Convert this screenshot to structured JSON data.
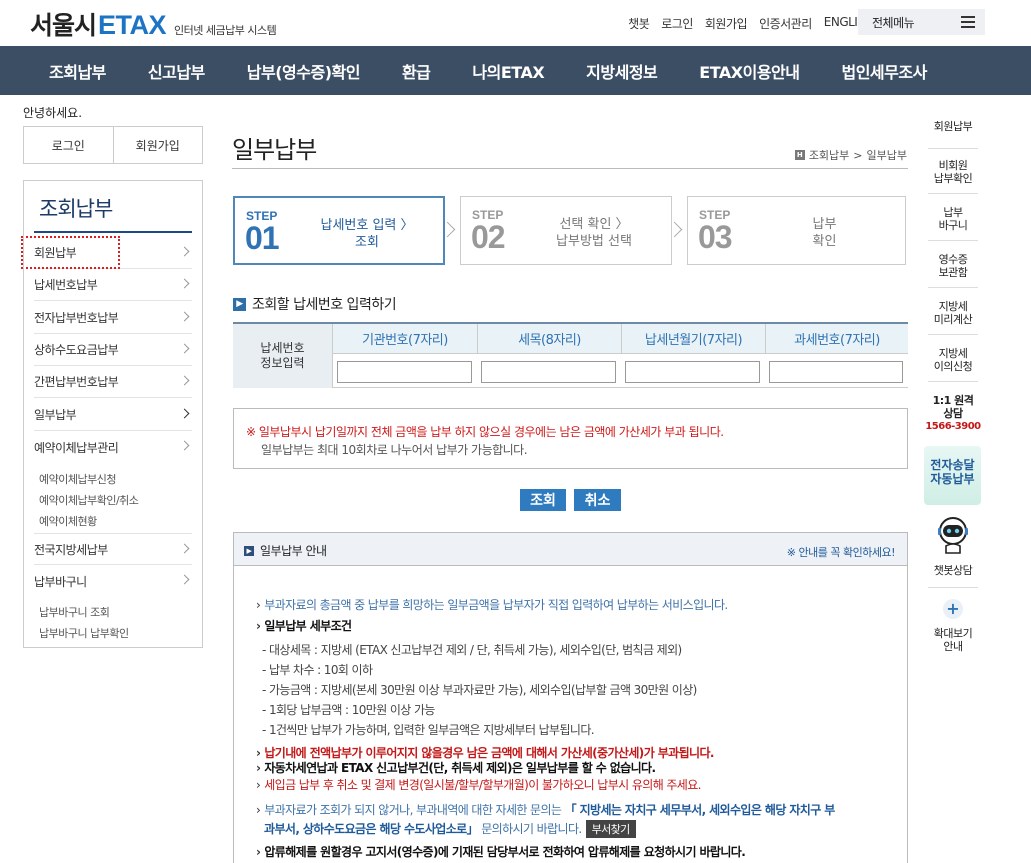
{
  "header": {
    "logo_main": "서울시",
    "logo_etax": "ETAX",
    "logo_sub": "인터넷 세금납부 시스템",
    "util_links": [
      "챗봇",
      "로그인",
      "회원가입",
      "인증서관리",
      "ENGLISH"
    ],
    "all_menu": "전체메뉴"
  },
  "gnb": [
    "조회납부",
    "신고납부",
    "납부(영수증)확인",
    "환급",
    "나의ETAX",
    "지방세정보",
    "ETAX이용안내",
    "법인세무조사"
  ],
  "left": {
    "greeting": "안녕하세요.",
    "login": "로그인",
    "join": "회원가입",
    "lnb_title": "조회납부",
    "items": [
      "회원납부",
      "납세번호납부",
      "전자납부번호납부",
      "상하수도요금납부",
      "간편납부번호납부",
      "일부납부",
      "예약이체납부관리"
    ],
    "reserve_sub": [
      "예약이체납부신청",
      "예약이체납부확인/취소",
      "예약이체현황"
    ],
    "items2": [
      "전국지방세납부",
      "납부바구니"
    ],
    "basket_sub": [
      "납부바구니 조회",
      "납부바구니 납부확인"
    ]
  },
  "content": {
    "title": "일부납부",
    "breadcrumb_home": "H",
    "breadcrumb": [
      "조회납부",
      "일부납부"
    ],
    "steps": [
      {
        "label": "STEP",
        "num": "01",
        "line1": "납세번호 입력 〉",
        "line2": "조회"
      },
      {
        "label": "STEP",
        "num": "02",
        "line1": "선택 확인 〉",
        "line2": "납부방법 선택"
      },
      {
        "label": "STEP",
        "num": "03",
        "line1": "납부",
        "line2": "확인"
      }
    ],
    "section_title": "조회할 납세번호 입력하기",
    "grid_head_1": "납세번호",
    "grid_head_2": "정보입력",
    "columns": [
      "기관번호(7자리)",
      "세목(8자리)",
      "납세년월기(7자리)",
      "과세번호(7자리)"
    ],
    "inputs": [
      "",
      "",
      "",
      ""
    ],
    "notice1": "※ 일부납부시 납기일까지 전체 금액을 납부 하지 않으실 경우에는 남은 금액에 가산세가 부과 됩니다.",
    "notice2": "일부납부는 최대 10회차로 나누어서 납부가 가능합니다.",
    "btn_search": "조회",
    "btn_cancel": "취소",
    "guide_title": "일부납부 안내",
    "guide_note": "※ 안내를 꼭 확인하세요!",
    "g1": "부과자료의 총금액 중 납부를 희망하는 일부금액을 납부자가 직접 입력하여 납부하는 서비스입니다.",
    "g2": "일부납부 세부조건",
    "g2_sub": [
      "- 대상세목 : 지방세 (ETAX 신고납부건 제외 / 단, 취득세 가능), 세외수입(단, 범칙금 제외)",
      "- 납부 차수 : 10회 이하",
      "- 가능금액 : 지방세(본세 30만원 이상 부과자료만 가능), 세외수입(납부할 금액 30만원 이상)",
      "- 1회당 납부금액 : 10만원 이상 가능",
      "- 1건씩만 납부가 가능하며, 입력한 일부금액은 지방세부터 납부됩니다."
    ],
    "g3": "납기내에 전액납부가 이루어지지 않을경우 남은 금액에 대해서 가산세(중가산세)가 부과됩니다.",
    "g4": "자동차세연납과 ETAX 신고납부건(단, 취득세 제외)은 일부납부를 할 수 없습니다.",
    "g5": "세입금 납부 후 취소 및 결제 변경(일시불/할부/할부개월)이 불가하오니 납부시 유의해 주세요.",
    "g6a": "부과자료가 조회가 되지 않거나, 부과내역에 대한 자세한 문의는",
    "g6b": "「 지방세는 자치구 세무부서, 세외수입은 해당 자치구 부",
    "g6c": "과부서, 상하수도요금은 해당 수도사업소로」",
    "g6d": "문의하시기 바랍니다.",
    "g6_btn": "부서찾기",
    "g7": "압류해제를 원할경우 고지서(영수증)에 기재된 담당부서로 전화하여 압류해제를 요청하시기 바랍니다."
  },
  "rail": {
    "items": [
      "회원납부",
      "비회원\n납부확인",
      "납부\n바구니",
      "영수증\n보관함",
      "지방세\n미리계산",
      "지방세\n이의신청"
    ],
    "consult_1": "1:1 원격",
    "consult_2": "상담",
    "phone": "1566-3900",
    "auto_pay_1": "전자송달",
    "auto_pay_2": "자동납부",
    "chatbot": "챗봇상담",
    "zoom_1": "확대보기",
    "zoom_2": "안내"
  }
}
